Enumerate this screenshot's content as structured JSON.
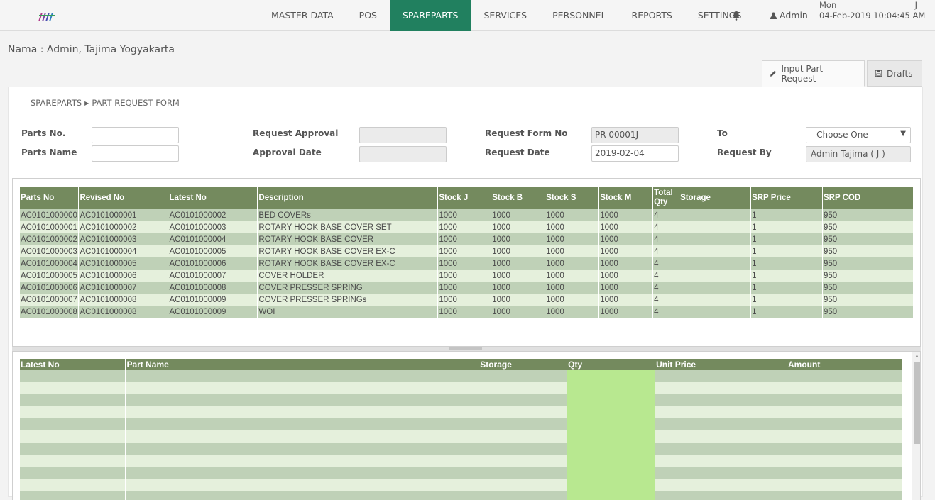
{
  "nav": {
    "items": [
      {
        "label": "MASTER DATA",
        "active": false
      },
      {
        "label": "POS",
        "active": false
      },
      {
        "label": "SPAREPARTS",
        "active": true
      },
      {
        "label": "SERVICES",
        "active": false
      },
      {
        "label": "PERSONNEL",
        "active": false
      },
      {
        "label": "REPORTS",
        "active": false
      },
      {
        "label": "SETTINGS",
        "active": false
      }
    ],
    "user_label": "Admin",
    "clock_day": "Mon",
    "clock_suffix": "J",
    "clock_datetime": "04-Feb-2019 10:04:45 AM",
    "accent_color": "#21805f"
  },
  "page": {
    "nama": "Nama : Admin, Tajima Yogyakarta",
    "tabs": [
      {
        "label": "Input Part Request",
        "icon": "pencil-icon",
        "active": true
      },
      {
        "label": "Drafts",
        "icon": "floppy-icon",
        "active": false
      }
    ],
    "breadcrumb": {
      "root": "SPAREPARTS",
      "current": "PART REQUEST FORM"
    }
  },
  "form": {
    "parts_no_label": "Parts No.",
    "parts_no_value": "",
    "parts_name_label": "Parts Name",
    "parts_name_value": "",
    "request_approval_label": "Request Approval",
    "request_approval_value": "",
    "approval_date_label": "Approval Date",
    "approval_date_value": "",
    "request_form_no_label": "Request Form No",
    "request_form_no_value": "PR 00001J",
    "request_date_label": "Request Date",
    "request_date_value": "2019-02-04",
    "to_label": "To",
    "to_value": "- Choose One -",
    "request_by_label": "Request By",
    "request_by_value": "Admin Tajima ( J )"
  },
  "parts_table": {
    "headers": [
      "Parts No",
      "Revised No",
      "Latest No",
      "Description",
      "Stock J",
      "Stock B",
      "Stock S",
      "Stock M",
      "Total Qty",
      "Storage",
      "SRP Price",
      "SRP COD"
    ],
    "rows": [
      [
        "AC0101000000",
        "AC0101000001",
        "AC0101000002",
        "BED COVERs",
        "1000",
        "1000",
        "1000",
        "1000",
        "4",
        "",
        "1",
        "950"
      ],
      [
        "AC0101000001",
        "AC0101000002",
        "AC0101000003",
        "ROTARY HOOK BASE COVER SET",
        "1000",
        "1000",
        "1000",
        "1000",
        "4",
        "",
        "1",
        "950"
      ],
      [
        "AC0101000002",
        "AC0101000003",
        "AC0101000004",
        "ROTARY HOOK BASE COVER",
        "1000",
        "1000",
        "1000",
        "1000",
        "4",
        "",
        "1",
        "950"
      ],
      [
        "AC0101000003",
        "AC0101000004",
        "AC0101000005",
        "ROTARY HOOK BASE COVER EX-C",
        "1000",
        "1000",
        "1000",
        "1000",
        "4",
        "",
        "1",
        "950"
      ],
      [
        "AC0101000004",
        "AC0101000005",
        "AC0101000006",
        "ROTARY HOOK BASE COVER EX-C",
        "1000",
        "1000",
        "1000",
        "1000",
        "4",
        "",
        "1",
        "950"
      ],
      [
        "AC0101000005",
        "AC0101000006",
        "AC0101000007",
        "COVER HOLDER",
        "1000",
        "1000",
        "1000",
        "1000",
        "4",
        "",
        "1",
        "950"
      ],
      [
        "AC0101000006",
        "AC0101000007",
        "AC0101000008",
        "COVER PRESSER SPRING",
        "1000",
        "1000",
        "1000",
        "1000",
        "4",
        "",
        "1",
        "950"
      ],
      [
        "AC0101000007",
        "AC0101000008",
        "AC0101000009",
        "COVER PRESSER SPRINGs",
        "1000",
        "1000",
        "1000",
        "1000",
        "4",
        "",
        "1",
        "950"
      ],
      [
        "AC0101000008",
        "AC0101000008",
        "AC0101000009",
        "WOI",
        "1000",
        "1000",
        "1000",
        "1000",
        "4",
        "",
        "1",
        "950"
      ]
    ]
  },
  "request_table": {
    "headers": [
      "Latest No",
      "Part Name",
      "Storage",
      "Qty",
      "Unit Price",
      "Amount"
    ]
  }
}
